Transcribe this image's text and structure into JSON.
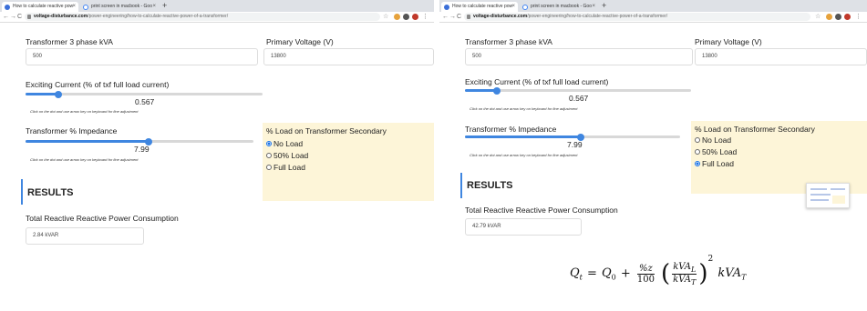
{
  "browser": {
    "tab1_title": "How to calculate reactive pow",
    "tab2_title": "print screen in macbook - Goo",
    "url_domain": "voltage-disturbance.com",
    "url_path": "/power-engineering/how-to-calculate-reactive-power-of-a-transformer/"
  },
  "left": {
    "kva_label": "Transformer 3 phase kVA",
    "kva_value": "500",
    "voltage_label": "Primary Voltage (V)",
    "voltage_value": "13800",
    "exciting_label": "Exciting Current (% of txf full load current)",
    "exciting_value": "0.567",
    "exciting_fraction": 0.14,
    "hint": "Click on the dot and use arrow key on keyboard for fine adjustment",
    "impedance_label": "Transformer % Impedance",
    "impedance_value": "7.99",
    "impedance_fraction": 0.54,
    "load_title": "% Load on Transformer Secondary",
    "load_options": [
      "No Load",
      "50% Load",
      "Full Load"
    ],
    "load_selected": 0,
    "results_title": "RESULTS",
    "result_label": "Total Reactive Reactive Power Consumption",
    "result_value": "2.84 kVAR"
  },
  "right": {
    "kva_label": "Transformer 3 phase kVA",
    "kva_value": "500",
    "voltage_label": "Primary Voltage (V)",
    "voltage_value": "13800",
    "exciting_label": "Exciting Current (% of txf full load current)",
    "exciting_value": "0.567",
    "exciting_fraction": 0.14,
    "hint": "Click on the dot and use arrow key on keyboard for fine adjustment",
    "impedance_label": "Transformer % Impedance",
    "impedance_value": "7.99",
    "impedance_fraction": 0.54,
    "load_title": "% Load on Transformer Secondary",
    "load_options": [
      "No Load",
      "50% Load",
      "Full Load"
    ],
    "load_selected": 2,
    "results_title": "RESULTS",
    "result_label": "Total Reactive Reactive Power Consumption",
    "result_value": "42.79 kVAR"
  },
  "formula": {
    "lhs": "Q",
    "lhs_sub": "t",
    "eq": "=",
    "q0": "Q",
    "q0_sub": "0",
    "plus": "+",
    "pct_num": "%z",
    "pct_den": "100",
    "ratio_num": "kVA",
    "ratio_num_sub": "L",
    "ratio_den": "kVA",
    "ratio_den_sub": "T",
    "power": "2",
    "tail": "kVA",
    "tail_sub": "T"
  },
  "colors": {
    "accent": "#3f86e0",
    "highlight_box": "#fdf5d8",
    "tab_bar": "#dee1e6"
  }
}
